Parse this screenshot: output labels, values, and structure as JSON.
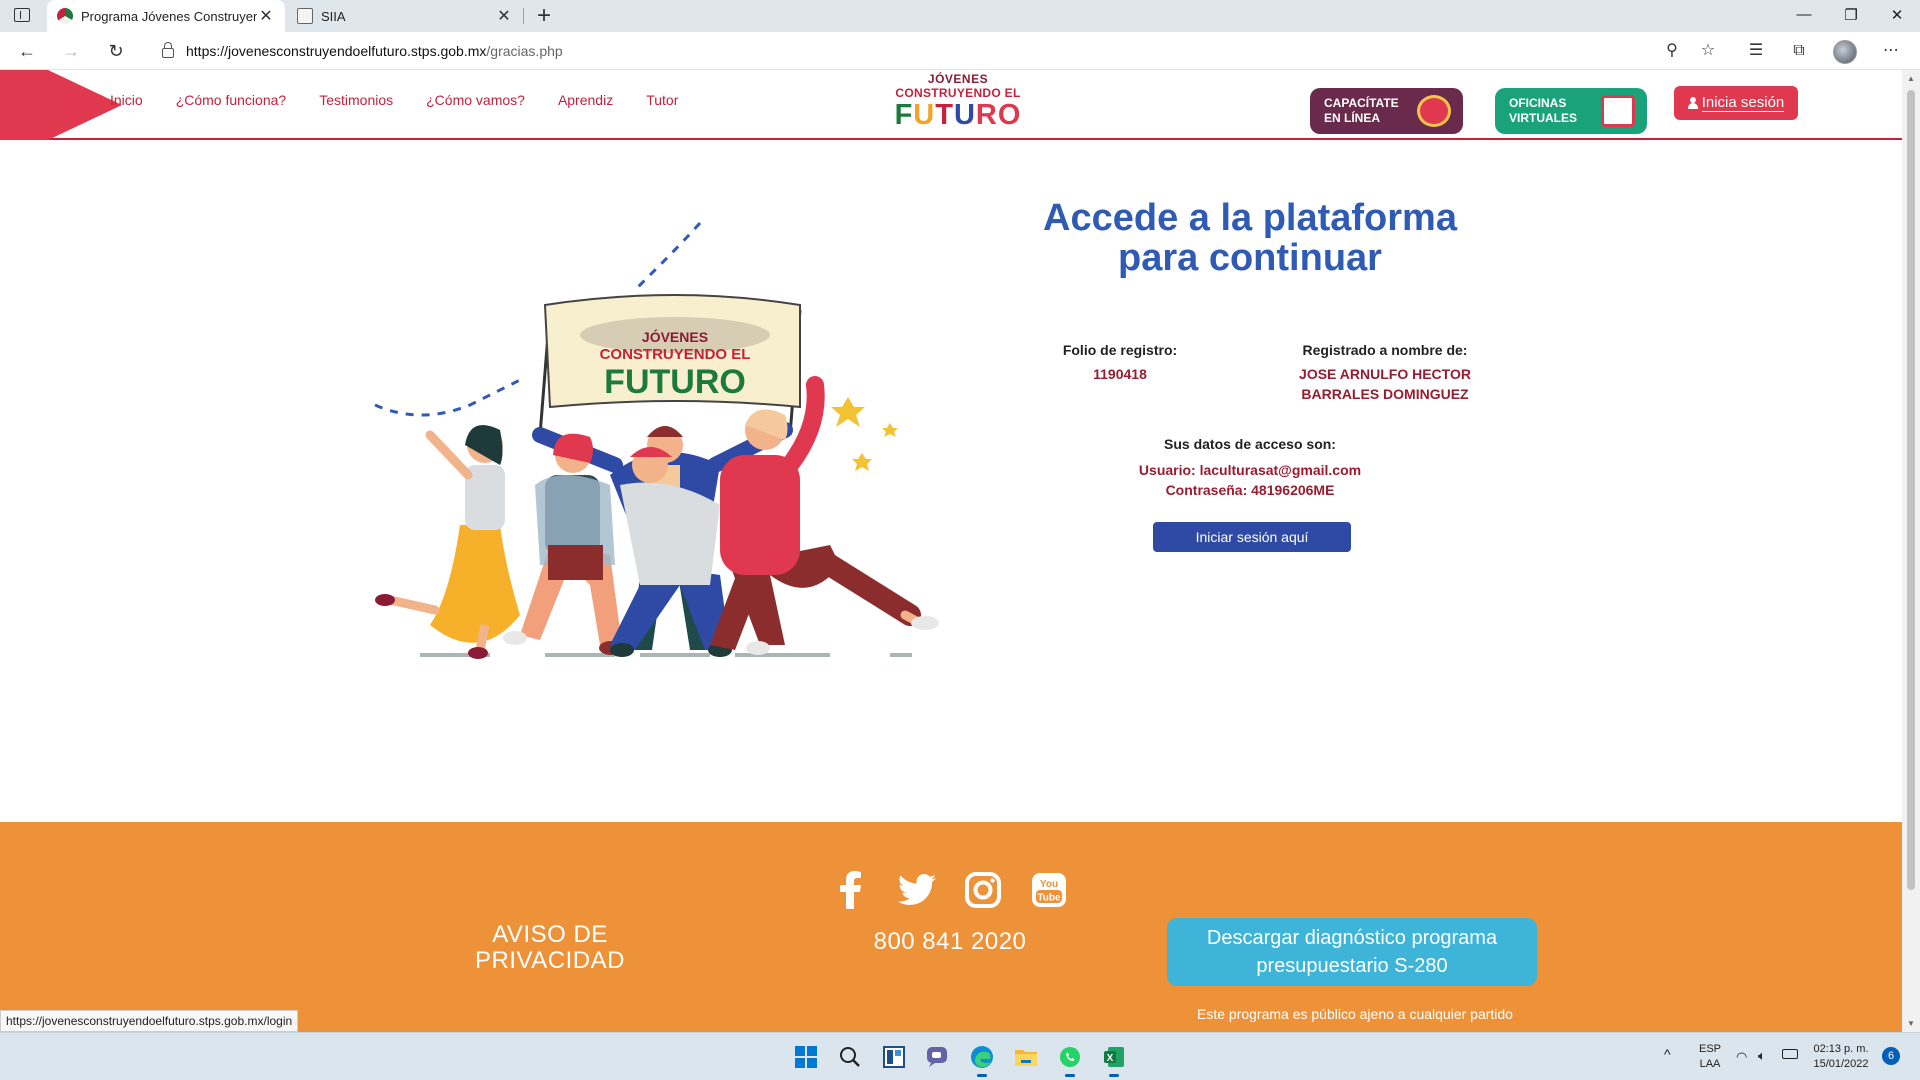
{
  "browser": {
    "tabs": [
      {
        "title": "Programa Jóvenes Construyendo el Futuro",
        "active": true
      },
      {
        "title": "SIIA",
        "active": false
      }
    ],
    "url_domain": "https://jovenesconstruyendoelfuturo.stps.gob.mx",
    "url_path": "/gracias.php",
    "status_link": "https://jovenesconstruyendoelfuturo.stps.gob.mx/login"
  },
  "header": {
    "nav": [
      "Inicio",
      "¿Cómo funciona?",
      "Testimonios",
      "¿Cómo vamos?",
      "Aprendiz",
      "Tutor"
    ],
    "logo": {
      "line1": "JÓVENES",
      "line2": "CONSTRUYENDO EL",
      "line3_letters": [
        "F",
        "U",
        "T",
        "U",
        "RO"
      ]
    },
    "badge_capacitate": {
      "line1": "CAPACÍTATE",
      "line2": "EN LÍNEA"
    },
    "badge_oficinas": {
      "line1": "OFICINAS",
      "line2": "VIRTUALES"
    },
    "login_label": "Inicia sesión"
  },
  "illustration": {
    "banner_line1": "JÓVENES",
    "banner_line2": "CONSTRUYENDO EL",
    "banner_line3": "FUTURO"
  },
  "main": {
    "heading_line1": "Accede a la plataforma",
    "heading_line2": "para continuar",
    "folio_label": "Folio de registro:",
    "folio_value": "1190418",
    "registered_label": "Registrado a nombre de:",
    "registered_name_line1": "JOSE ARNULFO HECTOR",
    "registered_name_line2": "BARRALES DOMINGUEZ",
    "access_label": "Sus datos de acceso son:",
    "user_line": "Usuario: laculturasat@gmail.com",
    "password_line": "Contraseña: 48196206ME",
    "login_button": "Iniciar sesión aquí"
  },
  "footer": {
    "aviso_line1": "AVISO DE",
    "aviso_line2": "PRIVACIDAD",
    "social_icons": [
      "facebook-icon",
      "twitter-icon",
      "instagram-icon",
      "youtube-icon"
    ],
    "youtube_text": "You\nTube",
    "phone": "800 841 2020",
    "download_line1": "Descargar diagnóstico programa",
    "download_line2": "presupuestario S-280",
    "disclaimer": "Este programa es público ajeno a cualquier partido"
  },
  "taskbar": {
    "lang_line1": "ESP",
    "lang_line2": "LAA",
    "time": "02:13 p. m.",
    "date": "15/01/2022",
    "notifications": "6"
  },
  "colors": {
    "primary_red": "#c6213b",
    "heading_blue": "#2f5bb5",
    "footer_orange": "#ee9239",
    "button_blue": "#2f4aa5",
    "download_cyan": "#3db4d8"
  }
}
